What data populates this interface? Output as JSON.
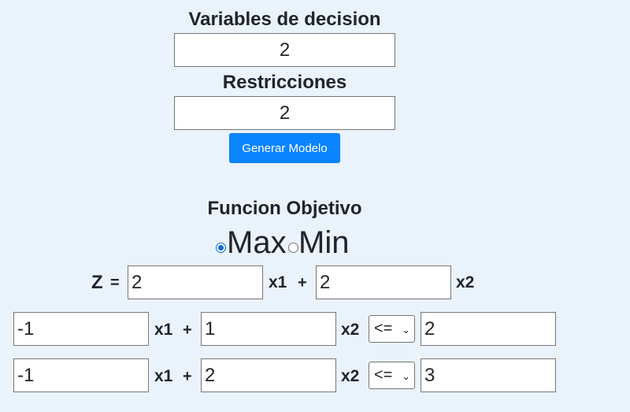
{
  "setup": {
    "variables_label": "Variables de decision",
    "variables_value": "2",
    "restrictions_label": "Restricciones",
    "restrictions_value": "2",
    "generate_button": "Generar Modelo"
  },
  "objective": {
    "title": "Funcion Objetivo",
    "max_label": "Max",
    "min_label": "Min",
    "selected": "Max",
    "z_label": "Z",
    "equals": "=",
    "coef1": "2",
    "var1": "x1",
    "plus": "+",
    "coef2": "2",
    "var2": "x2"
  },
  "constraints": [
    {
      "coef1": "-1",
      "var1": "x1",
      "plus": "+",
      "coef2": "1",
      "var2": "x2",
      "operator": "<=",
      "rhs": "2"
    },
    {
      "coef1": "-1",
      "var1": "x1",
      "plus": "+",
      "coef2": "2",
      "var2": "x2",
      "operator": "<=",
      "rhs": "3"
    }
  ],
  "colors": {
    "background": "#eaf2fb",
    "accent": "#0b84ff",
    "radio_checked": "#0b6ed8"
  },
  "icons": {
    "select_arrow": "chevron-down-icon"
  }
}
